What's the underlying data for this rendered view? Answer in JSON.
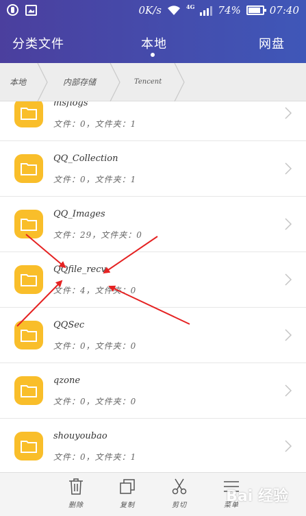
{
  "status_bar": {
    "net_speed": "0K/s",
    "network_type": "4G",
    "battery": "74%",
    "time": "07:40",
    "icons": [
      "app-notification-icon",
      "image-notification-icon",
      "wifi-icon",
      "signal-icon",
      "battery-icon"
    ]
  },
  "tabs": {
    "category": "分类文件",
    "local": "本地",
    "cloud": "网盘",
    "active": "local"
  },
  "breadcrumb": [
    "本地",
    "内部存储",
    "Tencent"
  ],
  "files": [
    {
      "name": "msflogs",
      "meta": "文件：0，文件夹：1"
    },
    {
      "name": "QQ_Collection",
      "meta": "文件：0，文件夹：1"
    },
    {
      "name": "QQ_Images",
      "meta": "文件：29，文件夹：0"
    },
    {
      "name": "QQfile_recv",
      "meta": "文件：4，文件夹：0"
    },
    {
      "name": "QQSec",
      "meta": "文件：0，文件夹：0"
    },
    {
      "name": "qzone",
      "meta": "文件：0，文件夹：0"
    },
    {
      "name": "shouyoubao",
      "meta": "文件：0，文件夹：1"
    }
  ],
  "toolbar": {
    "delete": "删除",
    "copy": "复制",
    "cut": "剪切",
    "menu": "菜单"
  },
  "watermark": "Bai 经验",
  "colors": {
    "header": "#4b3f9e",
    "folder": "#f9be2a",
    "annotation_arrow": "#e52222"
  }
}
